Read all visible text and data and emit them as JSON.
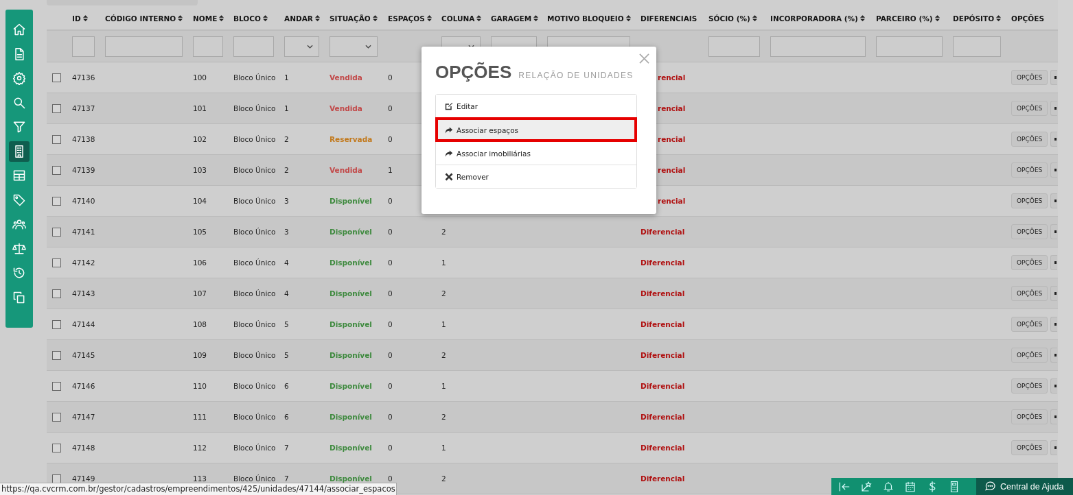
{
  "sidebar": {
    "items": [
      {
        "kind": "home",
        "selected": false
      },
      {
        "kind": "document",
        "selected": false
      },
      {
        "kind": "gear",
        "selected": false
      },
      {
        "kind": "search",
        "selected": false
      },
      {
        "kind": "filter",
        "selected": false
      },
      {
        "kind": "building",
        "selected": true
      },
      {
        "kind": "table",
        "selected": false
      },
      {
        "kind": "tag",
        "selected": false
      },
      {
        "kind": "users",
        "selected": false
      },
      {
        "kind": "scale",
        "selected": false
      },
      {
        "kind": "history",
        "selected": false
      },
      {
        "kind": "copy",
        "selected": false
      }
    ]
  },
  "table": {
    "columns": [
      {
        "label": "ID",
        "sortable": true,
        "filter": {
          "kind": "text"
        }
      },
      {
        "label": "CÓDIGO INTERNO",
        "sortable": true,
        "filter": {
          "kind": "text"
        }
      },
      {
        "label": "NOME",
        "sortable": true,
        "filter": {
          "kind": "text"
        }
      },
      {
        "label": "BLOCO",
        "sortable": true,
        "filter": {
          "kind": "text"
        }
      },
      {
        "label": "ANDAR",
        "sortable": true,
        "filter": {
          "kind": "select"
        }
      },
      {
        "label": "SITUAÇÃO",
        "sortable": true,
        "filter": {
          "kind": "select"
        }
      },
      {
        "label": "ESPAÇOS",
        "sortable": true
      },
      {
        "label": "COLUNA",
        "sortable": true,
        "filter": {
          "kind": "select"
        }
      },
      {
        "label": "GARAGEM",
        "sortable": true,
        "filter": {
          "kind": "text"
        }
      },
      {
        "label": "MOTIVO BLOQUEIO",
        "sortable": true,
        "filter": {
          "kind": "text"
        }
      },
      {
        "label": "DIFERENCIAIS",
        "sortable": false
      },
      {
        "label": "SÓCIO (%)",
        "sortable": true,
        "filter": {
          "kind": "text"
        }
      },
      {
        "label": "INCORPORADORA (%)",
        "sortable": true,
        "filter": {
          "kind": "text"
        }
      },
      {
        "label": "PARCEIRO (%)",
        "sortable": true,
        "filter": {
          "kind": "text"
        }
      },
      {
        "label": "DEPÓSITO",
        "sortable": true,
        "filter": {
          "kind": "text"
        }
      },
      {
        "label": "OPÇÕES",
        "sortable": false
      }
    ],
    "rows": [
      {
        "checked": false,
        "id": "47136",
        "nome": "100",
        "bloco": "Bloco Único",
        "andar": "1",
        "situacao": {
          "text": "Vendida",
          "color": "#c24848"
        },
        "espacos": "0",
        "diferencial_cut": "rencial",
        "options": "OPÇÕES"
      },
      {
        "checked": false,
        "id": "47137",
        "nome": "101",
        "bloco": "Bloco Único",
        "andar": "1",
        "situacao": {
          "text": "Vendida",
          "color": "#c24848"
        },
        "espacos": "0",
        "diferencial_cut": "rencial",
        "options": "OPÇÕES"
      },
      {
        "checked": false,
        "id": "47138",
        "nome": "102",
        "bloco": "Bloco Único",
        "andar": "2",
        "situacao": {
          "text": "Reservada",
          "color": "#c27a1e"
        },
        "espacos": "0",
        "diferencial_cut": "rencial",
        "options": "OPÇÕES"
      },
      {
        "checked": false,
        "id": "47139",
        "nome": "103",
        "bloco": "Bloco Único",
        "andar": "2",
        "situacao": {
          "text": "Vendida",
          "color": "#c24848"
        },
        "espacos": "1",
        "diferencial_cut": "rencial",
        "options": "OPÇÕES"
      },
      {
        "checked": false,
        "id": "47140",
        "nome": "104",
        "bloco": "Bloco Único",
        "andar": "3",
        "situacao": {
          "text": "Disponível",
          "color": "#3e8a3e"
        },
        "espacos": "0",
        "diferencial_cut": "rencial",
        "options": "OPÇÕES"
      },
      {
        "checked": false,
        "id": "47141",
        "nome": "105",
        "bloco": "Bloco Único",
        "andar": "3",
        "situacao": {
          "text": "Disponível",
          "color": "#3e8a3e"
        },
        "espacos": "0",
        "coluna": "2",
        "diferencial": "Diferencial",
        "options": "OPÇÕES"
      },
      {
        "checked": false,
        "id": "47142",
        "nome": "106",
        "bloco": "Bloco Único",
        "andar": "4",
        "situacao": {
          "text": "Disponível",
          "color": "#3e8a3e"
        },
        "espacos": "0",
        "coluna": "1",
        "diferencial": "Diferencial",
        "options": "OPÇÕES"
      },
      {
        "checked": false,
        "id": "47143",
        "nome": "107",
        "bloco": "Bloco Único",
        "andar": "4",
        "situacao": {
          "text": "Disponível",
          "color": "#3e8a3e"
        },
        "espacos": "0",
        "coluna": "2",
        "diferencial": "Diferencial",
        "options": "OPÇÕES"
      },
      {
        "checked": false,
        "id": "47144",
        "nome": "108",
        "bloco": "Bloco Único",
        "andar": "5",
        "situacao": {
          "text": "Disponível",
          "color": "#3e8a3e"
        },
        "espacos": "0",
        "coluna": "1",
        "diferencial": "Diferencial",
        "options": "OPÇÕES"
      },
      {
        "checked": false,
        "id": "47145",
        "nome": "109",
        "bloco": "Bloco Único",
        "andar": "5",
        "situacao": {
          "text": "Disponível",
          "color": "#3e8a3e"
        },
        "espacos": "0",
        "coluna": "2",
        "diferencial": "Diferencial",
        "options": "OPÇÕES"
      },
      {
        "checked": false,
        "id": "47146",
        "nome": "110",
        "bloco": "Bloco Único",
        "andar": "6",
        "situacao": {
          "text": "Disponível",
          "color": "#3e8a3e"
        },
        "espacos": "0",
        "coluna": "1",
        "diferencial": "Diferencial",
        "options": "OPÇÕES"
      },
      {
        "checked": false,
        "id": "47147",
        "nome": "111",
        "bloco": "Bloco Único",
        "andar": "6",
        "situacao": {
          "text": "Disponível",
          "color": "#3e8a3e"
        },
        "espacos": "0",
        "coluna": "2",
        "diferencial": "Diferencial",
        "options": "OPÇÕES"
      },
      {
        "checked": false,
        "id": "47148",
        "nome": "112",
        "bloco": "Bloco Único",
        "andar": "7",
        "situacao": {
          "text": "Disponível",
          "color": "#3e8a3e"
        },
        "espacos": "0",
        "coluna": "1",
        "diferencial": "Diferencial",
        "options": "OPÇÕES"
      },
      {
        "checked": false,
        "id": "47149",
        "nome": "113",
        "bloco": "Bloco Único",
        "andar": "7",
        "situacao": {
          "text": "Disponível",
          "color": "#3e8a3e"
        },
        "espacos": "0",
        "coluna": "2",
        "diferencial": "Diferencial"
      }
    ]
  },
  "modal": {
    "title": "OPÇÕES",
    "subtitle": "RELAÇÃO DE UNIDADES",
    "items": [
      {
        "kind": "edit",
        "label": "Editar",
        "selected": false
      },
      {
        "kind": "share",
        "label": "Associar espaços",
        "selected": true
      },
      {
        "kind": "share",
        "label": "Associar imobiliárias",
        "selected": false
      },
      {
        "kind": "remove",
        "label": "Remover",
        "selected": false
      }
    ]
  },
  "status_link": "https://qa.cvcrm.com.br/gestor/cadastros/empreendimentos/425/unidades/47144/associar_espacos",
  "bottom_bar": {
    "tools": [
      {
        "kind": "collapse"
      },
      {
        "kind": "magic"
      },
      {
        "kind": "bell"
      },
      {
        "kind": "calendar"
      },
      {
        "kind": "dollar"
      },
      {
        "kind": "calculator"
      }
    ],
    "help_label": "Central de Ajuda"
  }
}
